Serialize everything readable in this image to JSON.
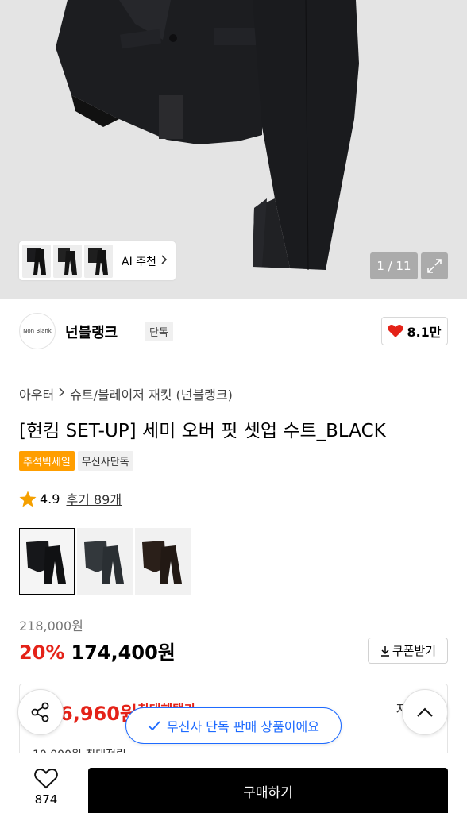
{
  "gallery": {
    "ai_recommend_label": "AI 추천",
    "counter": "1 / 11"
  },
  "brand": {
    "logo_text": "Non Blank",
    "name": "넌블랭크",
    "tag": "단독",
    "likes": "8.1만"
  },
  "breadcrumb": {
    "category": "아우터",
    "subcategory": "슈트/블레이저 재킷 (넌블랭크)"
  },
  "product": {
    "title": "[현킴 SET-UP] 세미 오버 핏 셋업 수트_BLACK",
    "badges": [
      "추석빅세일",
      "무신사단독"
    ],
    "rating": "4.9",
    "reviews": "후기 89개"
  },
  "colors": [
    "black",
    "charcoal",
    "brown"
  ],
  "pricing": {
    "original_price": "218,000원",
    "discount": "20%",
    "price": "174,400원",
    "coupon_label": "쿠폰받기"
  },
  "benefit": {
    "max_price": "6,960원",
    "label": "최대혜택가",
    "detail_label": "자세히",
    "sub_text": "10,000원 최대적립"
  },
  "toast": {
    "text": "무신사 단독 판매 상품이에요"
  },
  "bottom_bar": {
    "wish_count": "874",
    "buy_label": "구매하기"
  },
  "theme": {
    "accent_red": "#e42218",
    "toast_blue": "#1e6bff",
    "badge_orange": "#ff9e00"
  }
}
